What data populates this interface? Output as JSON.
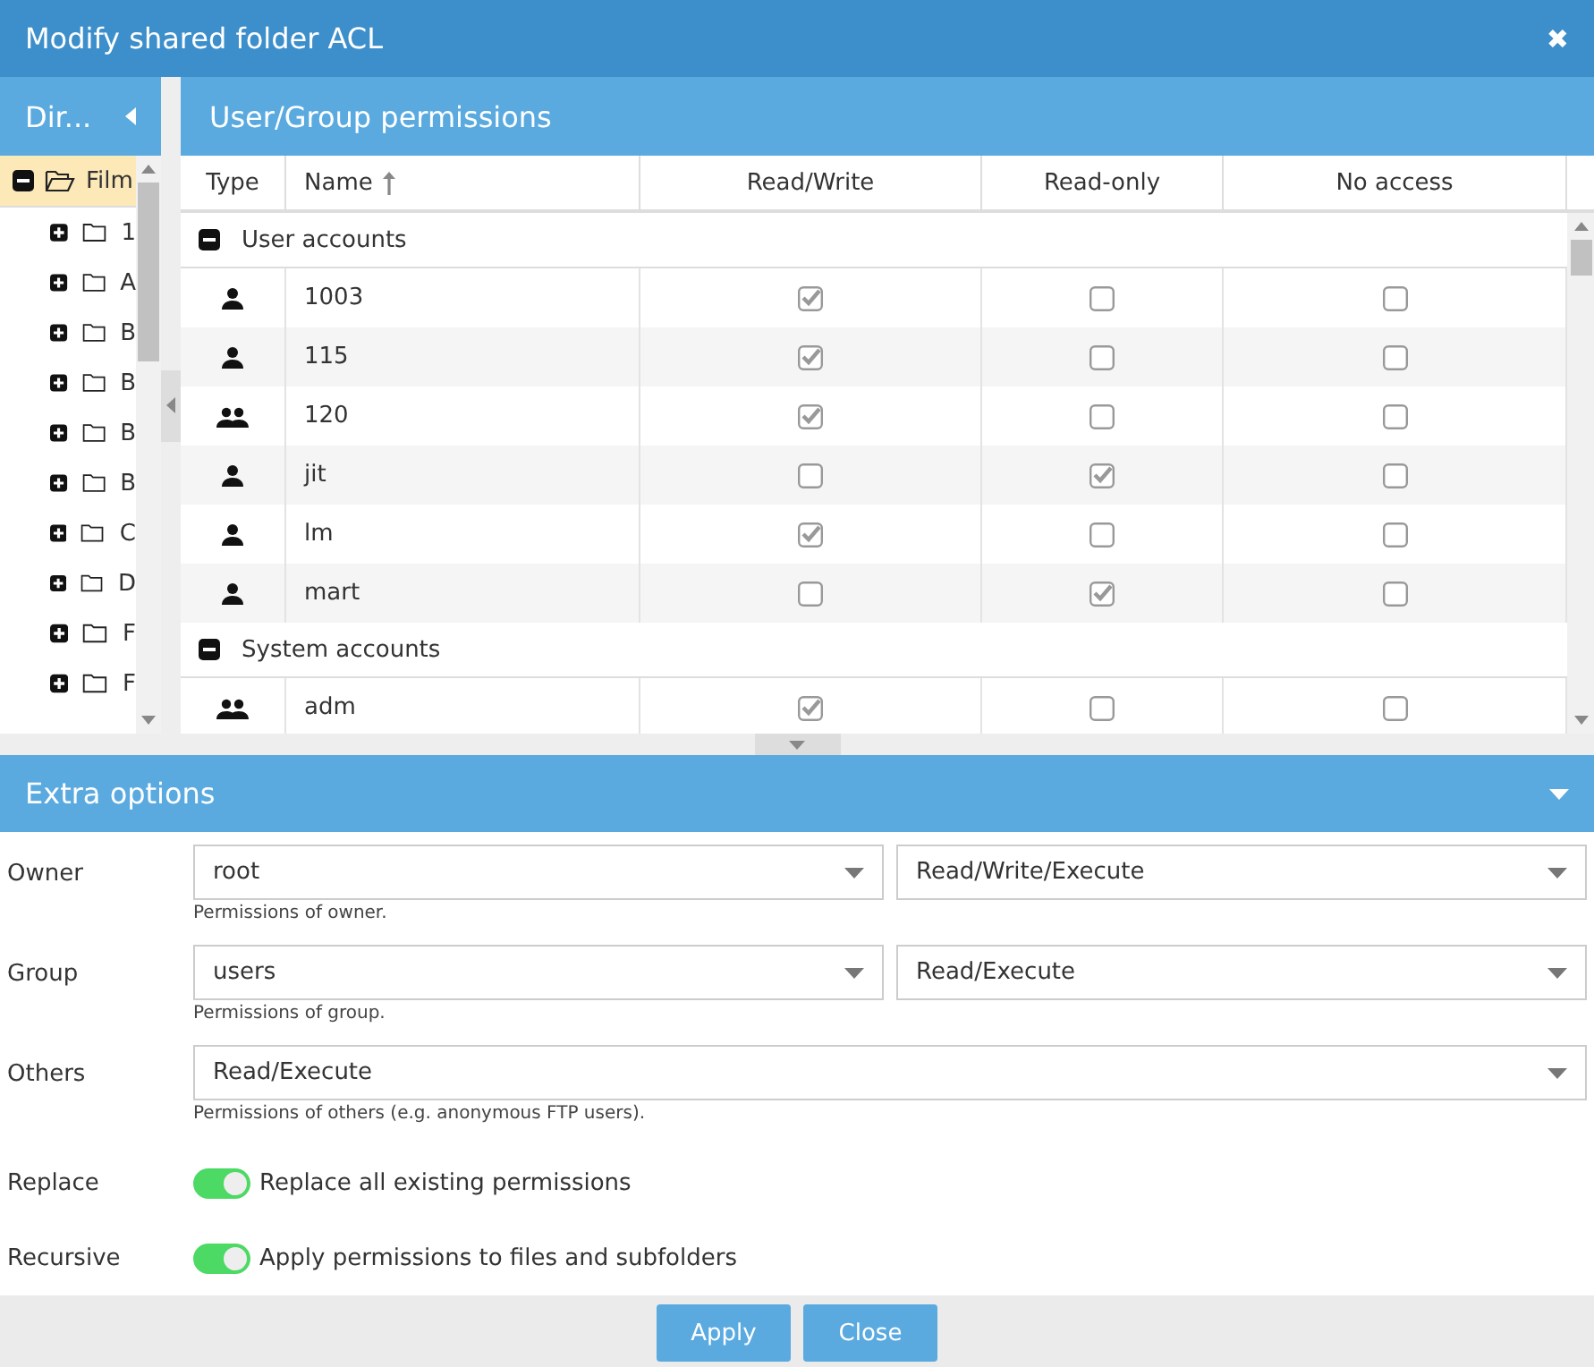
{
  "window": {
    "title": "Modify shared folder ACL",
    "close": "✖"
  },
  "sidebar": {
    "title": "Dir...",
    "tree": [
      {
        "label": "Film",
        "expanded": true,
        "selected": true,
        "children": [
          {
            "label": "1",
            "expanded": false,
            "selected": false
          },
          {
            "label": "A",
            "expanded": false,
            "selected": false
          },
          {
            "label": "B",
            "expanded": false,
            "selected": false
          },
          {
            "label": "B",
            "expanded": false,
            "selected": false
          },
          {
            "label": "B",
            "expanded": false,
            "selected": false
          },
          {
            "label": "B",
            "expanded": false,
            "selected": false
          },
          {
            "label": "C",
            "expanded": false,
            "selected": false
          },
          {
            "label": "D",
            "expanded": false,
            "selected": false
          },
          {
            "label": "F",
            "expanded": false,
            "selected": false
          },
          {
            "label": "F",
            "expanded": false,
            "selected": false
          }
        ]
      }
    ]
  },
  "permissions": {
    "title": "User/Group permissions",
    "columns": [
      {
        "label": "Type",
        "sorted": false
      },
      {
        "label": "Name",
        "sorted": true
      },
      {
        "label": "Read/Write",
        "sorted": false
      },
      {
        "label": "Read-only",
        "sorted": false
      },
      {
        "label": "No access",
        "sorted": false
      }
    ],
    "groups": [
      {
        "label": "User accounts",
        "expanded": true,
        "rows": [
          {
            "kind": "user",
            "name": "1003",
            "read_write": true,
            "read_only": false,
            "no_access": false
          },
          {
            "kind": "user",
            "name": "115",
            "read_write": true,
            "read_only": false,
            "no_access": false
          },
          {
            "kind": "group",
            "name": "120",
            "read_write": true,
            "read_only": false,
            "no_access": false
          },
          {
            "kind": "user",
            "name": "jit",
            "read_write": false,
            "read_only": true,
            "no_access": false
          },
          {
            "kind": "user",
            "name": "lm",
            "read_write": true,
            "read_only": false,
            "no_access": false
          },
          {
            "kind": "user",
            "name": "mart",
            "read_write": false,
            "read_only": true,
            "no_access": false
          }
        ]
      },
      {
        "label": "System accounts",
        "expanded": true,
        "rows": [
          {
            "kind": "group",
            "name": "adm",
            "read_write": true,
            "read_only": false,
            "no_access": false
          }
        ]
      }
    ]
  },
  "extra_options": {
    "title": "Extra options",
    "fields": [
      {
        "kind": "select2",
        "label": "Owner",
        "value": "root",
        "value2": "Read/Write/Execute",
        "hint": "Permissions of owner."
      },
      {
        "kind": "select2",
        "label": "Group",
        "value": "users",
        "value2": "Read/Execute",
        "hint": "Permissions of group."
      },
      {
        "kind": "select",
        "label": "Others",
        "value": "Read/Execute",
        "hint": "Permissions of others (e.g. anonymous FTP users)."
      },
      {
        "kind": "toggle",
        "label": "Replace",
        "on": true,
        "text": "Replace all existing permissions"
      },
      {
        "kind": "toggle",
        "label": "Recursive",
        "on": true,
        "text": "Apply permissions to files and subfolders"
      }
    ]
  },
  "buttons": [
    "Apply",
    "Close"
  ]
}
